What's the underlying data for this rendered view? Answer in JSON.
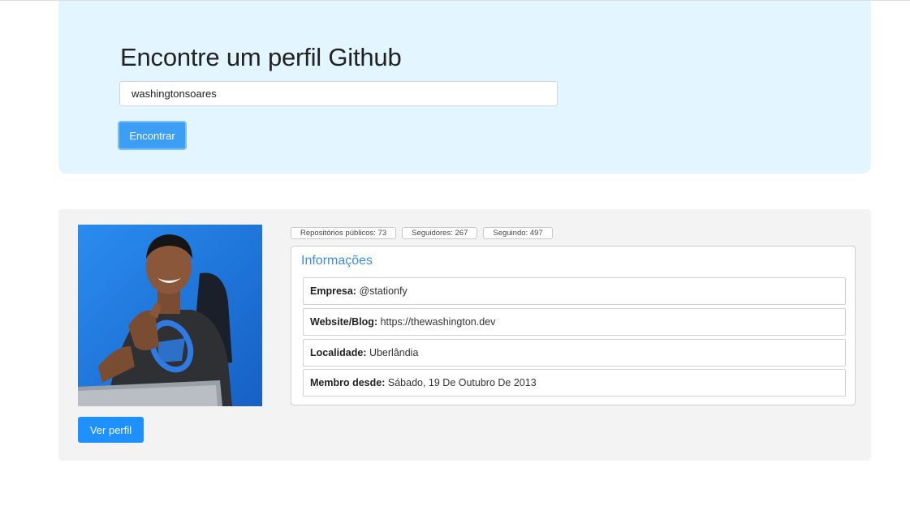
{
  "search": {
    "title": "Encontre um perfil Github",
    "input_value": "washingtonsoares",
    "button_label": "Encontrar"
  },
  "profile": {
    "avatar_alt": "foto de perfil",
    "view_button_label": "Ver perfil",
    "badges": {
      "repos": "Repositórios públicos: 73",
      "followers": "Seguidores: 267",
      "following": "Seguindo: 497"
    },
    "info": {
      "title": "Informações",
      "rows": [
        {
          "label": "Empresa:",
          "value": "@stationfy"
        },
        {
          "label": "Website/Blog:",
          "value": "https://thewashington.dev"
        },
        {
          "label": "Localidade:",
          "value": "Uberlândia"
        },
        {
          "label": "Membro desde:",
          "value": "Sábado, 19 De Outubro De 2013"
        }
      ]
    }
  },
  "colors": {
    "search_panel_bg": "#e3f5fe",
    "profile_panel_bg": "#f3f3f3",
    "primary_button": "#1e90ff",
    "info_title": "#3d8de0"
  }
}
